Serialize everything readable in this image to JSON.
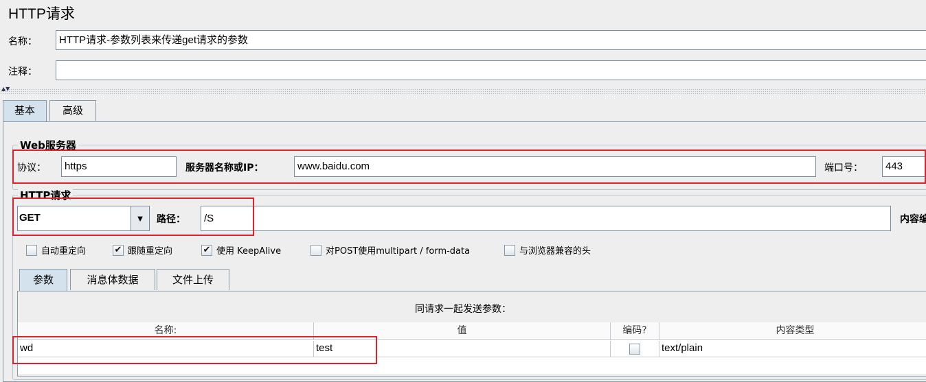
{
  "page": {
    "title": "HTTP请求"
  },
  "header": {
    "name_label": "名称：",
    "name_value": "HTTP请求-参数列表来传递get请求的参数",
    "comment_label": "注释：",
    "comment_value": ""
  },
  "tabs": [
    {
      "label": "基本",
      "active": true
    },
    {
      "label": "高级",
      "active": false
    }
  ],
  "web_server": {
    "legend": "Web服务器",
    "protocol_label": "协议：",
    "protocol_value": "https",
    "server_label": "服务器名称或IP：",
    "server_value": "www.baidu.com",
    "port_label": "端口号：",
    "port_value": "443"
  },
  "http_request": {
    "legend": "HTTP请求",
    "method_value": "GET",
    "path_label": "路径：",
    "path_value": "/S",
    "content_label": "内容编"
  },
  "options": [
    {
      "label": "自动重定向",
      "checked": false
    },
    {
      "label": "跟随重定向",
      "checked": true
    },
    {
      "label": "使用 KeepAlive",
      "checked": true
    },
    {
      "label": "对POST使用multipart / form-data",
      "checked": false
    },
    {
      "label": "与浏览器兼容的头",
      "checked": false
    }
  ],
  "subtabs": [
    {
      "label": "参数",
      "active": true
    },
    {
      "label": "消息体数据",
      "active": false
    },
    {
      "label": "文件上传",
      "active": false
    }
  ],
  "params": {
    "caption": "同请求一起发送参数：",
    "columns": [
      "名称:",
      "值",
      "编码?",
      "内容类型"
    ],
    "rows": [
      {
        "name": "wd",
        "value": "test",
        "encode": false,
        "content_type": "text/plain"
      }
    ]
  },
  "colors": {
    "highlight": "#e0202a",
    "active_tab": "#d4e2ee",
    "background": "#eeeeee"
  }
}
